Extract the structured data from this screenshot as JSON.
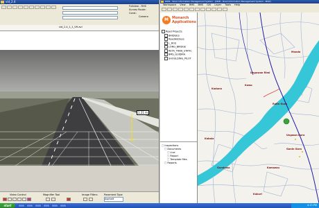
{
  "left_window": {
    "title": "vid_2.4",
    "video_caption": "vid_2.4_1_1_VH.avi",
    "right_info": [
      "Fullview - RHS",
      "Survey Route:",
      "Cond.:",
      "Camera"
    ],
    "measurement": "1.21 m",
    "bottom_groups": [
      {
        "label": "Video Control"
      },
      {
        "label": "Magnifier Tool"
      },
      {
        "label": "Image Filters"
      },
      {
        "label": "Pavement Type",
        "value": "Asphalt"
      }
    ],
    "colors": {
      "title_bar": "#2a5db0",
      "toolbar": "#ece9d8"
    }
  },
  "right_window": {
    "title": "RIMS - Road Information Management System - [NOB - Road Information Management System - MDP]",
    "menu": [
      "Workspace",
      "View",
      "RMS",
      "BMS",
      "GIS",
      "Layer",
      "Tools",
      "Help"
    ],
    "logo": {
      "letters": "M",
      "line1": "Monarch",
      "line2": "Applications"
    },
    "layer_tree": [
      "Road Projects",
      "BRIDGES",
      "RoadAddress",
      "L_ROS",
      "LONG_BRIDGE",
      "RETA_TRAN_STATIC",
      "BMS_GUIDIRA",
      "SHOULDING_PILOT"
    ],
    "doc_tree": [
      "Inspections",
      "Documents",
      "Live",
      "Report",
      "Template files",
      "Reports"
    ],
    "place_labels": [
      "Kaduna",
      "Mando",
      "Unguwan Rimi",
      "Rafin Guza",
      "Kawo",
      "Kabala",
      "Ungwan Boro",
      "Gonin Gora",
      "Gunduwa",
      "Kamazou",
      "Kakuri"
    ],
    "colors": {
      "river": "#35c6d8",
      "road_primary": "#1a1aaa",
      "road_secondary": "#8aa0c8",
      "marker": "#3aa040",
      "logo": "#f47b20"
    }
  },
  "taskbar": {
    "start_label": "start",
    "time": "4:15 PM"
  }
}
